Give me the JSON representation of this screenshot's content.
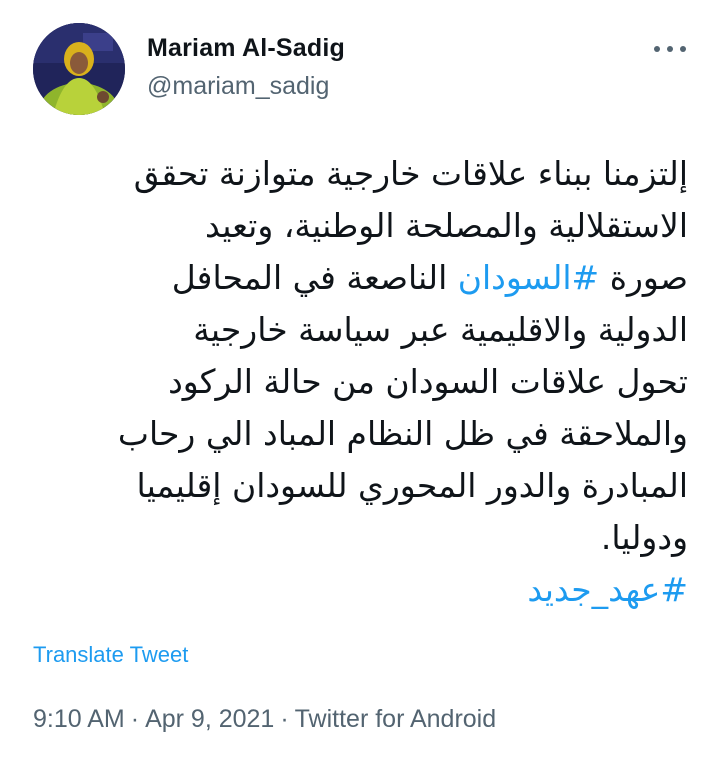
{
  "author": {
    "display_name": "Mariam Al-Sadig",
    "handle": "@mariam_sadig",
    "avatar_icon": "user-avatar"
  },
  "menu": {
    "more_icon": "more-options-icon"
  },
  "tweet": {
    "lines": [
      "إلتزمنا ببناء علاقات خارجية متوازنة تحقق",
      "الاستقلالية والمصلحة الوطنية، وتعيد",
      "الدولية والاقليمية عبر سياسة خارجية",
      "تحول علاقات السودان من حالة الركود",
      "والملاحقة في ظل النظام المباد الي رحاب",
      "المبادرة والدور المحوري للسودان إقليميا",
      "ودوليا."
    ],
    "line3_before": "صورة ",
    "line3_hashtag": "#السودان",
    "line3_after": " الناصعة في المحافل",
    "hashtag_final": "#عهد_جديد"
  },
  "translate_label": "Translate Tweet",
  "meta": {
    "time": "9:10 AM",
    "date": "Apr 9, 2021",
    "source": "Twitter for Android",
    "separator": "·"
  },
  "colors": {
    "text": "#0f1419",
    "secondary": "#536471",
    "link": "#1d9bf0"
  }
}
